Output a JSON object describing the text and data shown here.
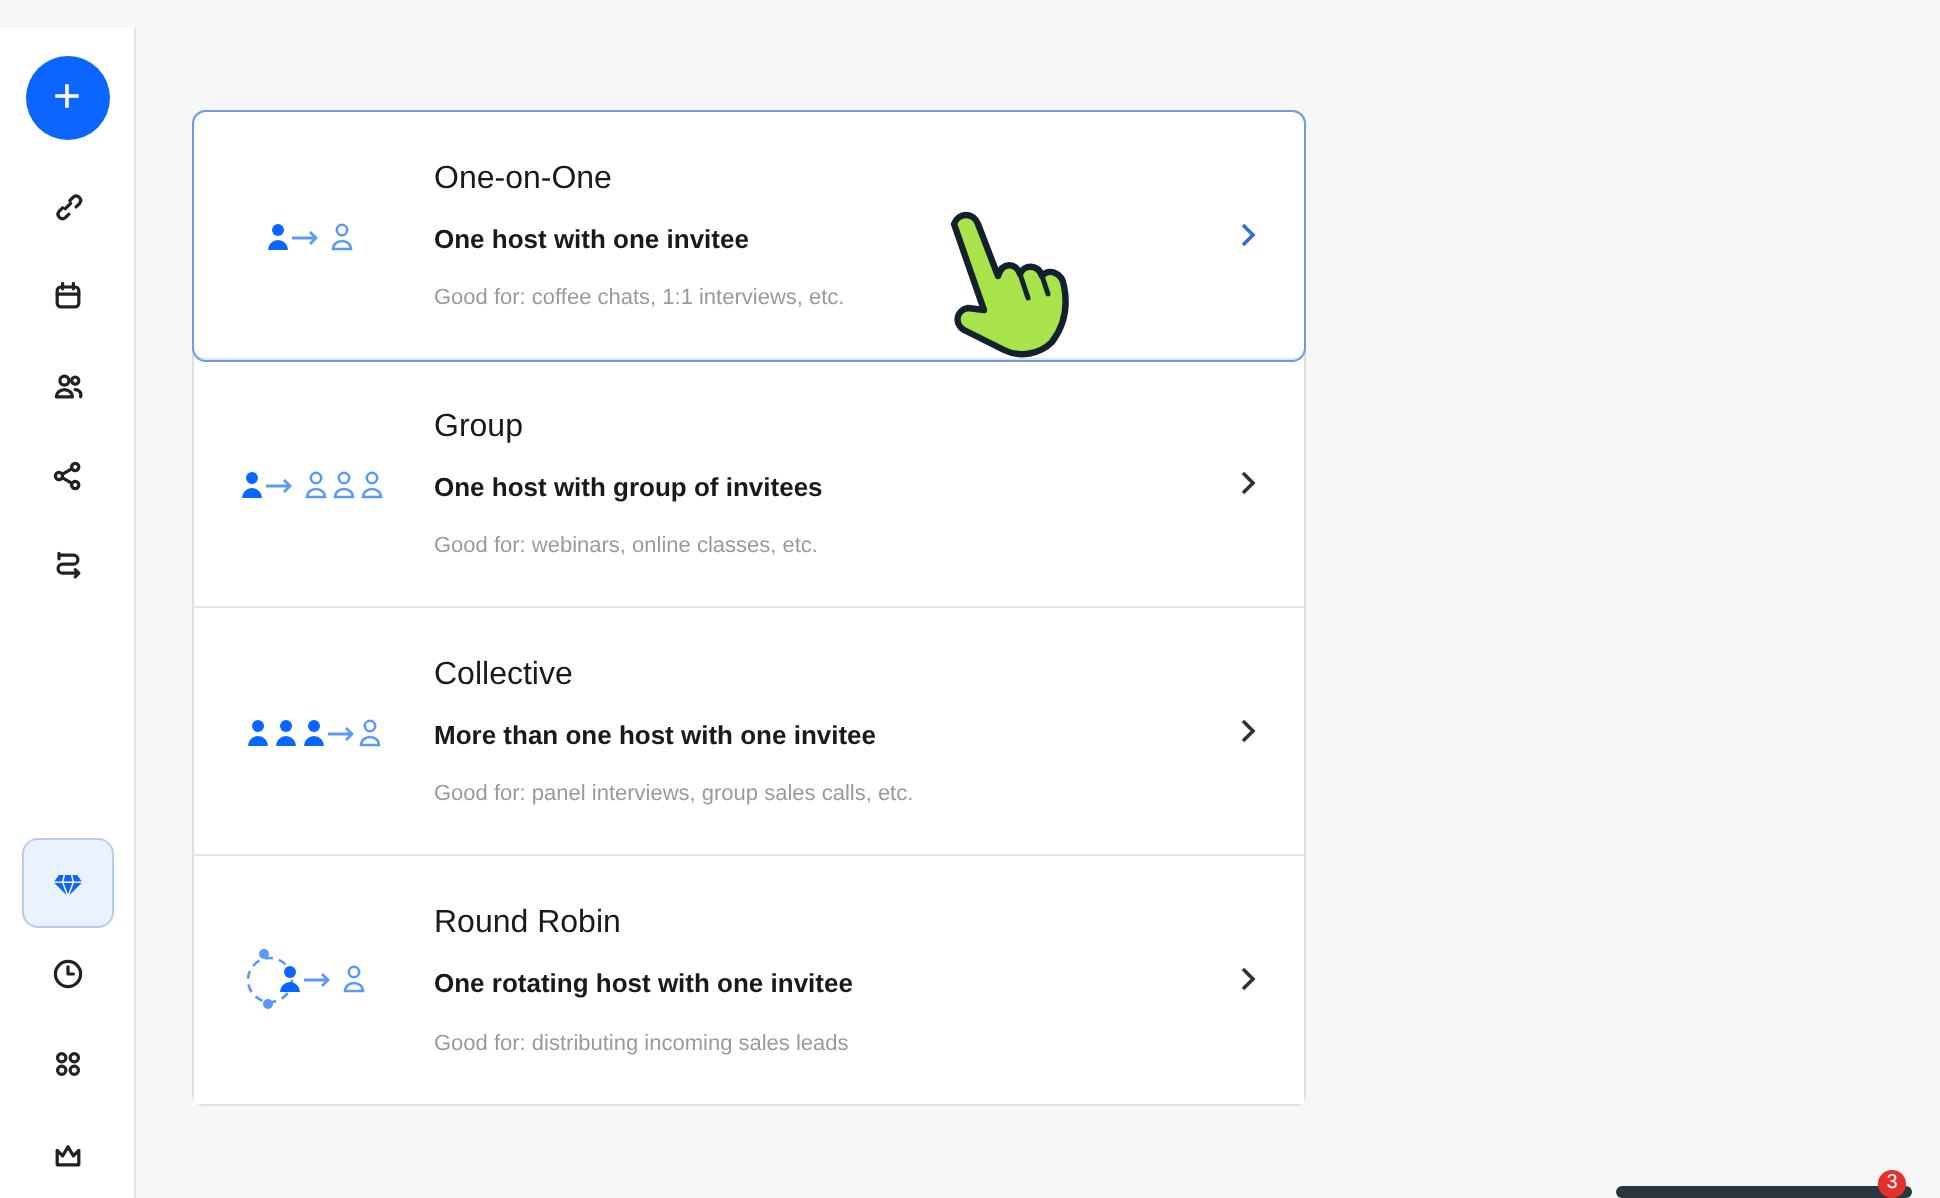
{
  "sidebar": {
    "create_button": {
      "label": "+"
    },
    "items": [
      {
        "kind": "link",
        "selected": false
      },
      {
        "kind": "calendar",
        "selected": false
      },
      {
        "kind": "people",
        "selected": false
      },
      {
        "kind": "share",
        "selected": false
      },
      {
        "kind": "route",
        "selected": false
      },
      {
        "kind": "gem",
        "selected": true
      },
      {
        "kind": "clock",
        "selected": false
      },
      {
        "kind": "apps",
        "selected": false
      },
      {
        "kind": "crown",
        "selected": false
      }
    ]
  },
  "event_types": [
    {
      "kind": "one-on-one",
      "title": "One-on-One",
      "subtitle": "One host with one invitee",
      "hint": "Good for: coffee chats, 1:1 interviews, etc.",
      "selected": true
    },
    {
      "kind": "group",
      "title": "Group",
      "subtitle": "One host with group of invitees",
      "hint": "Good for: webinars, online classes, etc.",
      "selected": false
    },
    {
      "kind": "collective",
      "title": "Collective",
      "subtitle": "More than one host with one invitee",
      "hint": "Good for: panel interviews, group sales calls, etc.",
      "selected": false
    },
    {
      "kind": "round-robin",
      "title": "Round Robin",
      "subtitle": "One rotating host with one invitee",
      "hint": "Good for: distributing incoming sales leads",
      "selected": false
    }
  ],
  "notification": {
    "count": "3"
  }
}
